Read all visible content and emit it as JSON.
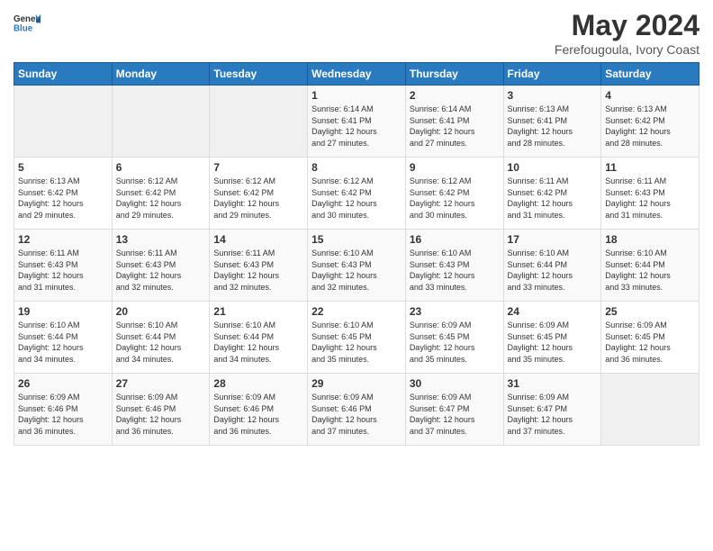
{
  "header": {
    "title": "May 2024",
    "subtitle": "Ferefougoula, Ivory Coast"
  },
  "columns": [
    "Sunday",
    "Monday",
    "Tuesday",
    "Wednesday",
    "Thursday",
    "Friday",
    "Saturday"
  ],
  "weeks": [
    [
      {
        "day": "",
        "info": ""
      },
      {
        "day": "",
        "info": ""
      },
      {
        "day": "",
        "info": ""
      },
      {
        "day": "1",
        "info": "Sunrise: 6:14 AM\nSunset: 6:41 PM\nDaylight: 12 hours\nand 27 minutes."
      },
      {
        "day": "2",
        "info": "Sunrise: 6:14 AM\nSunset: 6:41 PM\nDaylight: 12 hours\nand 27 minutes."
      },
      {
        "day": "3",
        "info": "Sunrise: 6:13 AM\nSunset: 6:41 PM\nDaylight: 12 hours\nand 28 minutes."
      },
      {
        "day": "4",
        "info": "Sunrise: 6:13 AM\nSunset: 6:42 PM\nDaylight: 12 hours\nand 28 minutes."
      }
    ],
    [
      {
        "day": "5",
        "info": "Sunrise: 6:13 AM\nSunset: 6:42 PM\nDaylight: 12 hours\nand 29 minutes."
      },
      {
        "day": "6",
        "info": "Sunrise: 6:12 AM\nSunset: 6:42 PM\nDaylight: 12 hours\nand 29 minutes."
      },
      {
        "day": "7",
        "info": "Sunrise: 6:12 AM\nSunset: 6:42 PM\nDaylight: 12 hours\nand 29 minutes."
      },
      {
        "day": "8",
        "info": "Sunrise: 6:12 AM\nSunset: 6:42 PM\nDaylight: 12 hours\nand 30 minutes."
      },
      {
        "day": "9",
        "info": "Sunrise: 6:12 AM\nSunset: 6:42 PM\nDaylight: 12 hours\nand 30 minutes."
      },
      {
        "day": "10",
        "info": "Sunrise: 6:11 AM\nSunset: 6:42 PM\nDaylight: 12 hours\nand 31 minutes."
      },
      {
        "day": "11",
        "info": "Sunrise: 6:11 AM\nSunset: 6:43 PM\nDaylight: 12 hours\nand 31 minutes."
      }
    ],
    [
      {
        "day": "12",
        "info": "Sunrise: 6:11 AM\nSunset: 6:43 PM\nDaylight: 12 hours\nand 31 minutes."
      },
      {
        "day": "13",
        "info": "Sunrise: 6:11 AM\nSunset: 6:43 PM\nDaylight: 12 hours\nand 32 minutes."
      },
      {
        "day": "14",
        "info": "Sunrise: 6:11 AM\nSunset: 6:43 PM\nDaylight: 12 hours\nand 32 minutes."
      },
      {
        "day": "15",
        "info": "Sunrise: 6:10 AM\nSunset: 6:43 PM\nDaylight: 12 hours\nand 32 minutes."
      },
      {
        "day": "16",
        "info": "Sunrise: 6:10 AM\nSunset: 6:43 PM\nDaylight: 12 hours\nand 33 minutes."
      },
      {
        "day": "17",
        "info": "Sunrise: 6:10 AM\nSunset: 6:44 PM\nDaylight: 12 hours\nand 33 minutes."
      },
      {
        "day": "18",
        "info": "Sunrise: 6:10 AM\nSunset: 6:44 PM\nDaylight: 12 hours\nand 33 minutes."
      }
    ],
    [
      {
        "day": "19",
        "info": "Sunrise: 6:10 AM\nSunset: 6:44 PM\nDaylight: 12 hours\nand 34 minutes."
      },
      {
        "day": "20",
        "info": "Sunrise: 6:10 AM\nSunset: 6:44 PM\nDaylight: 12 hours\nand 34 minutes."
      },
      {
        "day": "21",
        "info": "Sunrise: 6:10 AM\nSunset: 6:44 PM\nDaylight: 12 hours\nand 34 minutes."
      },
      {
        "day": "22",
        "info": "Sunrise: 6:10 AM\nSunset: 6:45 PM\nDaylight: 12 hours\nand 35 minutes."
      },
      {
        "day": "23",
        "info": "Sunrise: 6:09 AM\nSunset: 6:45 PM\nDaylight: 12 hours\nand 35 minutes."
      },
      {
        "day": "24",
        "info": "Sunrise: 6:09 AM\nSunset: 6:45 PM\nDaylight: 12 hours\nand 35 minutes."
      },
      {
        "day": "25",
        "info": "Sunrise: 6:09 AM\nSunset: 6:45 PM\nDaylight: 12 hours\nand 36 minutes."
      }
    ],
    [
      {
        "day": "26",
        "info": "Sunrise: 6:09 AM\nSunset: 6:46 PM\nDaylight: 12 hours\nand 36 minutes."
      },
      {
        "day": "27",
        "info": "Sunrise: 6:09 AM\nSunset: 6:46 PM\nDaylight: 12 hours\nand 36 minutes."
      },
      {
        "day": "28",
        "info": "Sunrise: 6:09 AM\nSunset: 6:46 PM\nDaylight: 12 hours\nand 36 minutes."
      },
      {
        "day": "29",
        "info": "Sunrise: 6:09 AM\nSunset: 6:46 PM\nDaylight: 12 hours\nand 37 minutes."
      },
      {
        "day": "30",
        "info": "Sunrise: 6:09 AM\nSunset: 6:47 PM\nDaylight: 12 hours\nand 37 minutes."
      },
      {
        "day": "31",
        "info": "Sunrise: 6:09 AM\nSunset: 6:47 PM\nDaylight: 12 hours\nand 37 minutes."
      },
      {
        "day": "",
        "info": ""
      }
    ]
  ]
}
